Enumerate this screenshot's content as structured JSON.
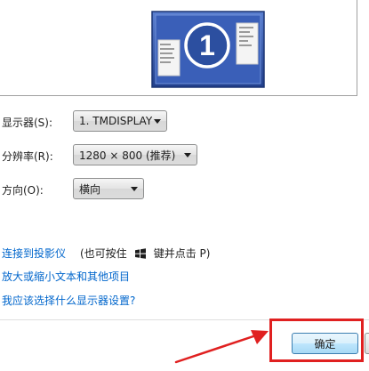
{
  "preview": {
    "monitor_number": "1"
  },
  "display": {
    "label": "显示器(S):",
    "value": "1. TMDISPLAY"
  },
  "resolution": {
    "label": "分辨率(R):",
    "value": "1280 × 800 (推荐)"
  },
  "orientation": {
    "label": "方向(O):",
    "value": "横向"
  },
  "links": {
    "projector": "连接到投影仪",
    "hint_prefix": "(也可按住",
    "hint_suffix": "键并点击 P)",
    "text_size": "放大或缩小文本和其他项目",
    "which_setting": "我应该选择什么显示器设置?"
  },
  "buttons": {
    "ok": "确定"
  },
  "colors": {
    "link": "#0066cc",
    "annotation": "#e02020",
    "monitor_blue": "#2c4fa0"
  },
  "icons": {
    "windows_key": "windows-logo-icon"
  }
}
